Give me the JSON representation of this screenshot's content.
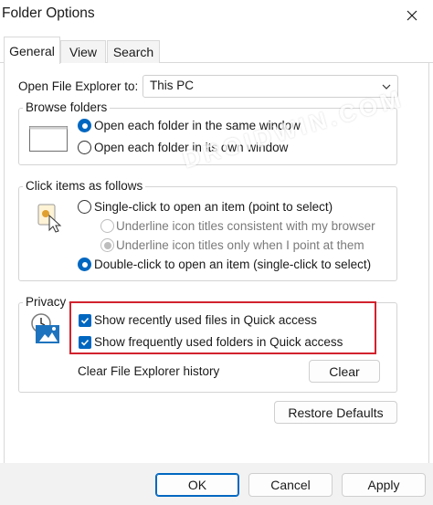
{
  "window": {
    "title": "Folder Options"
  },
  "tabs": [
    {
      "label": "General",
      "active": true
    },
    {
      "label": "View",
      "active": false
    },
    {
      "label": "Search",
      "active": false
    }
  ],
  "open_explorer": {
    "label": "Open File Explorer to:",
    "value": "This PC"
  },
  "browse_folders": {
    "legend": "Browse folders",
    "options": [
      {
        "label": "Open each folder in the same window",
        "selected": true
      },
      {
        "label": "Open each folder in its own window",
        "selected": false
      }
    ]
  },
  "click_items": {
    "legend": "Click items as follows",
    "single_click": {
      "label": "Single-click to open an item (point to select)",
      "selected": false
    },
    "underline_options": [
      {
        "label": "Underline icon titles consistent with my browser",
        "selected": false,
        "enabled": false
      },
      {
        "label": "Underline icon titles only when I point at them",
        "selected": true,
        "enabled": false
      }
    ],
    "double_click": {
      "label": "Double-click to open an item (single-click to select)",
      "selected": true
    }
  },
  "privacy": {
    "legend": "Privacy",
    "checkboxes": [
      {
        "label": "Show recently used files in Quick access",
        "checked": true
      },
      {
        "label": "Show frequently used folders in Quick access",
        "checked": true
      }
    ],
    "clear_label": "Clear File Explorer history",
    "clear_button": "Clear"
  },
  "restore_defaults_button": "Restore Defaults",
  "footer": {
    "ok": "OK",
    "cancel": "Cancel",
    "apply": "Apply"
  },
  "watermark": "DROIDWIN.COM",
  "colors": {
    "accent": "#0067c0",
    "highlight": "#d2222d",
    "footer_bg": "#f2f2f2"
  },
  "icons": [
    "close-icon",
    "chevron-down-icon",
    "folder-window-icon",
    "pointer-click-icon",
    "privacy-clock-icon",
    "checkmark-icon"
  ]
}
